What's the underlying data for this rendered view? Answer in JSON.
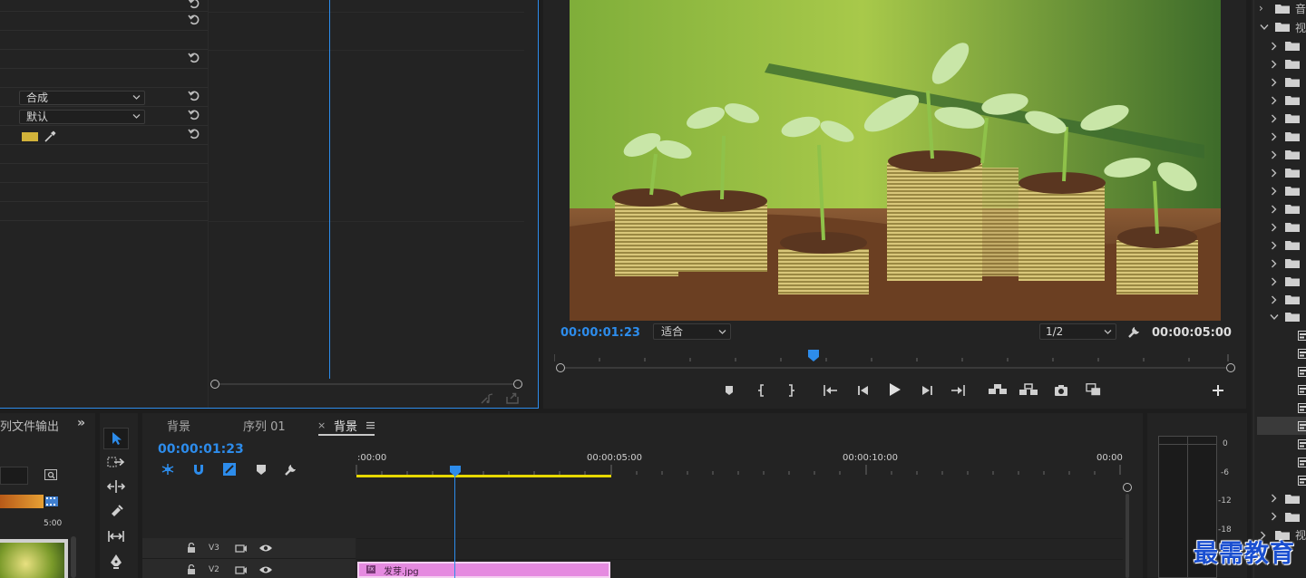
{
  "effect_controls": {
    "blend_mode": "合成",
    "interpolation": "默认",
    "swatch_color": "#d2b33a"
  },
  "program_monitor": {
    "current_timecode": "00:00:01:23",
    "fit_label": "适合",
    "resolution": "1/2",
    "duration": "00:00:05:00"
  },
  "left_panel": {
    "title_fragment": "列文件输出",
    "thumb_time": "5:00"
  },
  "timeline": {
    "tabs": [
      {
        "label": "背景",
        "closable": false,
        "active": false
      },
      {
        "label": "序列 01",
        "closable": false,
        "active": false
      },
      {
        "label": "背景",
        "closable": true,
        "active": true
      }
    ],
    "current_timecode": "00:00:01:23",
    "ruler_labels": [
      ":00:00",
      "00:00:05:00",
      "00:00:10:00",
      "00:00"
    ],
    "tracks": [
      {
        "name": "V3"
      },
      {
        "name": "V2"
      }
    ],
    "clip_label": "发芽.jpg",
    "clip_fx": "fx",
    "clip_color": "#e58ae0"
  },
  "audio_meter": {
    "scale": [
      "0",
      "-6",
      "-12",
      "-18"
    ]
  },
  "project_tree": {
    "label_top": "音",
    "label_video": "视",
    "label_bottom": "视"
  },
  "watermark": "最需教育",
  "colors": {
    "accent_blue": "#2d8ceb",
    "work_area_yellow": "#e6d800",
    "playhead": "#2d8ceb"
  }
}
